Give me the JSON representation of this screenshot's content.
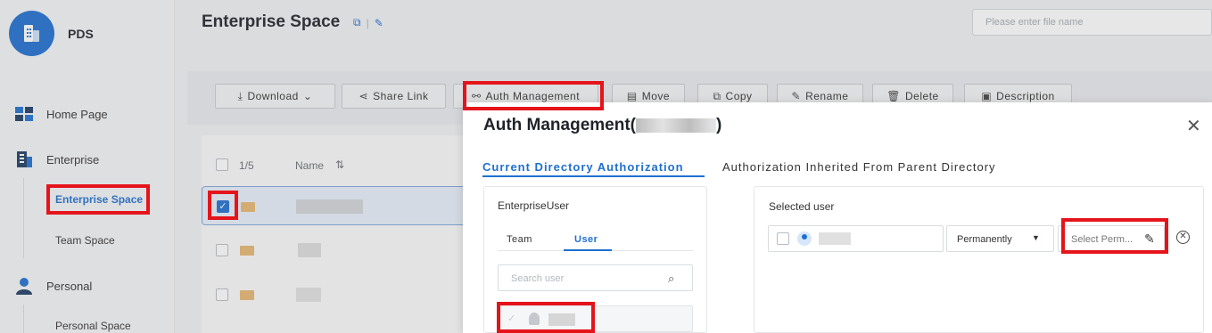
{
  "app": {
    "name": "PDS",
    "logo_icon": "building-icon",
    "brand_color": "#1f6fd0"
  },
  "sidebar": {
    "items": [
      {
        "label": "Home Page",
        "icon": "home-grid-icon"
      },
      {
        "label": "Enterprise",
        "icon": "enterprise-building-icon"
      },
      {
        "label": "Personal",
        "icon": "person-icon"
      }
    ],
    "enterprise_children": [
      "Enterprise Space",
      "Team Space"
    ],
    "personal_children": [
      "Personal Space"
    ],
    "active": "Enterprise Space"
  },
  "header": {
    "title": "Enterprise Space",
    "search_placeholder": "Please enter file name"
  },
  "toolbar": {
    "buttons": [
      {
        "label": "Download",
        "icon": "download-icon"
      },
      {
        "label": "Share Link",
        "icon": "share-icon"
      },
      {
        "label": "Auth Management",
        "icon": "auth-tree-icon"
      },
      {
        "label": "Move",
        "icon": "move-icon"
      },
      {
        "label": "Copy",
        "icon": "copy-icon"
      },
      {
        "label": "Rename",
        "icon": "edit-icon"
      },
      {
        "label": "Delete",
        "icon": "trash-icon"
      },
      {
        "label": "Description",
        "icon": "clipboard-icon"
      }
    ]
  },
  "table": {
    "selection_count": "1/5",
    "name_header": "Name",
    "sort_icon": "sort-icon"
  },
  "modal": {
    "title": "Auth Management(",
    "title_close": ")",
    "tabs": [
      "Current Directory Authorization",
      "Authorization Inherited From Parent Directory"
    ],
    "left_panel": {
      "heading": "EnterpriseUser",
      "tabs": [
        "Team",
        "User"
      ],
      "search_placeholder": "Search user"
    },
    "right_panel": {
      "heading": "Selected user",
      "duration_value": "Permanently",
      "permission_placeholder": "Select Perm..."
    }
  }
}
